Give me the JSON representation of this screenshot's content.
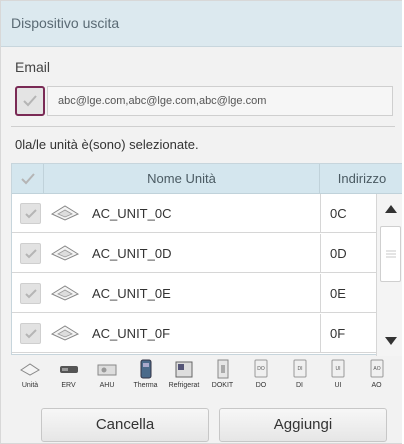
{
  "dialog": {
    "title": "Dispositivo uscita",
    "email_label": "Email",
    "email_value": "abc@lge.com,abc@lge.com,abc@lge.com",
    "selected_text": "0la/le unità è(sono) selezionate."
  },
  "table": {
    "col_name": "Nome Unità",
    "col_address": "Indirizzo",
    "rows": [
      {
        "name": "AC_UNIT_0C",
        "address": "0C"
      },
      {
        "name": "AC_UNIT_0D",
        "address": "0D"
      },
      {
        "name": "AC_UNIT_0E",
        "address": "0E"
      },
      {
        "name": "AC_UNIT_0F",
        "address": "0F"
      }
    ]
  },
  "types": [
    {
      "label": "Unità",
      "icon": "indoor-unit-icon"
    },
    {
      "label": "ERV",
      "icon": "erv-icon"
    },
    {
      "label": "AHU",
      "icon": "ahu-icon"
    },
    {
      "label": "Therma",
      "icon": "therma-icon"
    },
    {
      "label": "Refrigerat",
      "icon": "refrigerator-icon"
    },
    {
      "label": "DOKIT",
      "icon": "dokit-icon"
    },
    {
      "label": "DO",
      "icon": "do-icon",
      "glyph": "DO"
    },
    {
      "label": "DI",
      "icon": "di-icon",
      "glyph": "DI"
    },
    {
      "label": "UI",
      "icon": "ui-icon",
      "glyph": "UI"
    },
    {
      "label": "AO",
      "icon": "ao-icon",
      "glyph": "AO"
    }
  ],
  "buttons": {
    "cancel": "Cancella",
    "add": "Aggiungi"
  },
  "colors": {
    "header_bg": "#dce9ef",
    "table_header_bg": "#d4e6ee",
    "email_check_border": "#7a2a55"
  }
}
